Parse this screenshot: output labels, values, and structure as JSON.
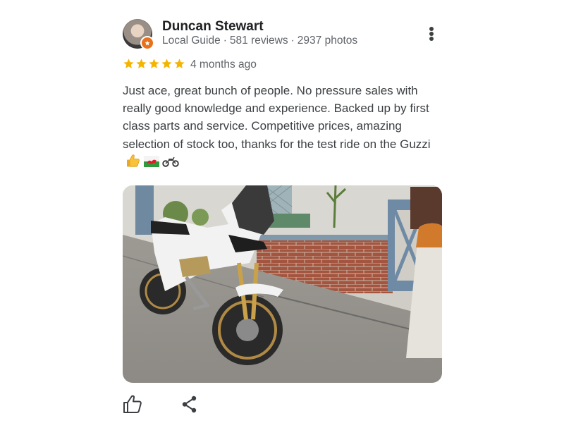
{
  "reviewer": {
    "name": "Duncan Stewart",
    "role": "Local Guide",
    "reviews": "581 reviews",
    "photos": "2937 photos",
    "separator": "·"
  },
  "rating": {
    "stars": 5,
    "max": 5,
    "date": "4 months ago"
  },
  "review_text": "Just ace, great bunch of people. No pressure sales with really good knowledge and experience. Backed up by first class parts and service. Competitive prices, amazing selection of stock too, thanks for the test ride on the Guzzi",
  "emojis": [
    "thumbs-up-emoji",
    "wales-flag-emoji",
    "motorcycle-emoji"
  ],
  "icons": {
    "more": "more-vert-icon",
    "like": "thumbs-up-icon",
    "share": "share-icon",
    "badge": "local-guide-badge-icon"
  },
  "colors": {
    "star": "#f4b400",
    "badge": "#e8711a",
    "name": "#202124",
    "meta": "#5f6368",
    "text": "#3c4043"
  }
}
